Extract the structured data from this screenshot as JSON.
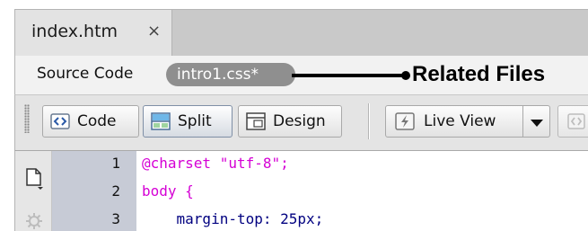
{
  "tabs": [
    {
      "label": "index.htm",
      "close": "×"
    }
  ],
  "related_bar": {
    "source_code_label": "Source Code",
    "related_file_label": "intro1.css*",
    "callout_label": "Related Files"
  },
  "toolbar": {
    "code_label": "Code",
    "split_label": "Split",
    "design_label": "Design",
    "live_view_label": "Live View",
    "active_view": "Split"
  },
  "editor": {
    "lines": [
      {
        "number": "1",
        "text": "@charset \"utf-8\";"
      },
      {
        "number": "2",
        "text": "body {"
      },
      {
        "number": "3",
        "text": "    margin-top: 25px;"
      }
    ]
  },
  "colors": {
    "at_rule": "#d500d5",
    "selector": "#d500d5",
    "property": "#000080",
    "pill_background": "#8f8f8f",
    "gutter_background": "#c7cbd6"
  },
  "icons": [
    "close-icon",
    "code-view-icon",
    "split-view-icon",
    "design-view-icon",
    "live-view-icon",
    "chevron-down-icon",
    "document-icon",
    "gear-icon"
  ]
}
